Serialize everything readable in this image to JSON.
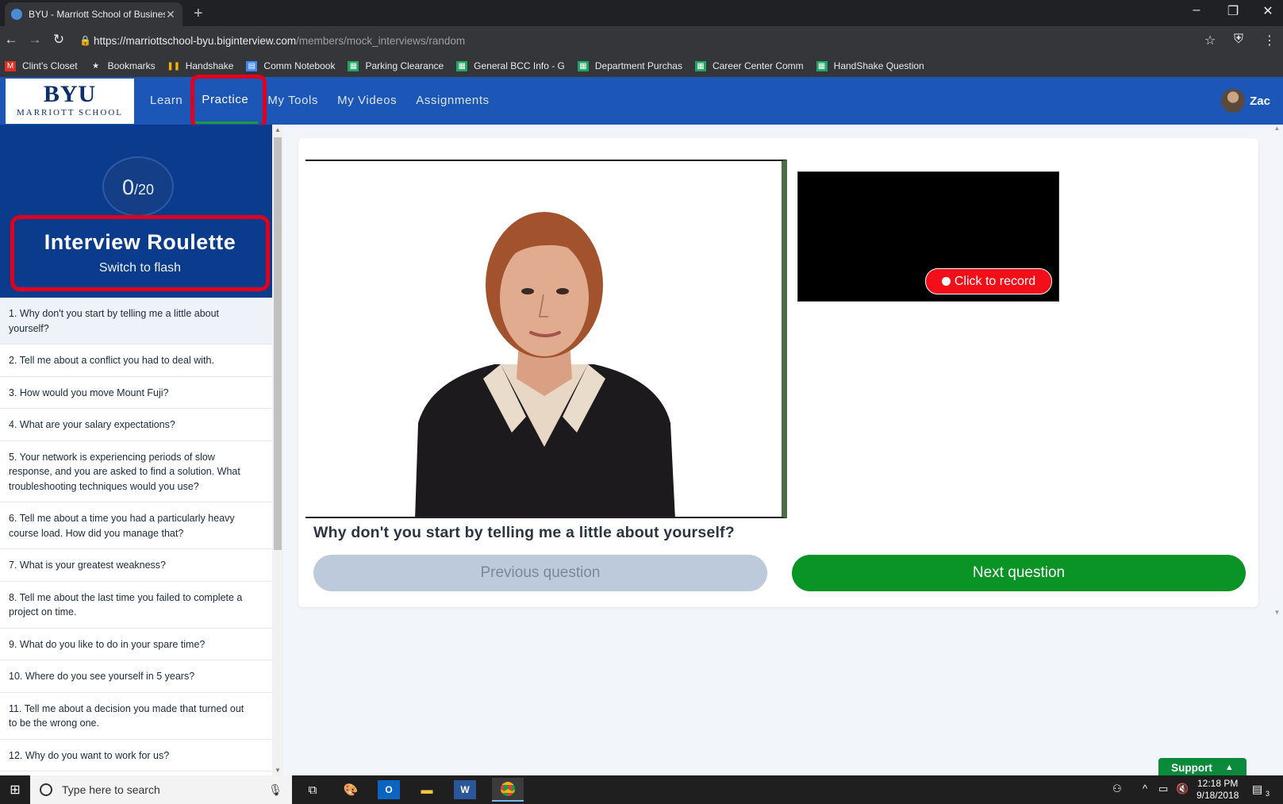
{
  "browser": {
    "tab_title": "BYU - Marriott School of Busines",
    "url_host": "https://marriottschool-byu.biginterview.com",
    "url_path": "/members/mock_interviews/random",
    "bookmarks": [
      {
        "label": "Clint's Closet",
        "icon": "red"
      },
      {
        "label": "Bookmarks",
        "icon": "star"
      },
      {
        "label": "Handshake",
        "icon": "hs"
      },
      {
        "label": "Comm Notebook",
        "icon": "doc"
      },
      {
        "label": "Parking Clearance",
        "icon": "sheet"
      },
      {
        "label": "General BCC Info - G",
        "icon": "sheet"
      },
      {
        "label": "Department Purchas",
        "icon": "sheet"
      },
      {
        "label": "Career Center Comm",
        "icon": "sheet"
      },
      {
        "label": "HandShake Question",
        "icon": "sheet"
      }
    ]
  },
  "site": {
    "logo_main": "BYU",
    "logo_sub": "MARRIOTT SCHOOL",
    "nav": [
      "Learn",
      "Practice",
      "My Tools",
      "My Videos",
      "Assignments"
    ],
    "active_nav": "Practice",
    "user_name": "Zac"
  },
  "sidebar": {
    "counter_value": "0",
    "counter_total": "/20",
    "title": "Interview Roulette",
    "subtitle": "Switch to flash",
    "questions": [
      "1. Why don't you start by telling me a little about yourself?",
      "2. Tell me about a conflict you had to deal with.",
      "3. How would you move Mount Fuji?",
      "4. What are your salary expectations?",
      "5. Your network is experiencing periods of slow response, and you are asked to find a solution. What troubleshooting techniques would you use?",
      "6. Tell me about a time you had a particularly heavy course load. How did you manage that?",
      "7. What is your greatest weakness?",
      "8. Tell me about the last time you failed to complete a project on time.",
      "9. What do you like to do in your spare time?",
      "10. Where do you see yourself in 5 years?",
      "11. Tell me about a decision you made that turned out to be the wrong one.",
      "12. Why do you want to work for us?"
    ]
  },
  "main": {
    "record_label": "Click to record",
    "question_text": "Why don't you start by telling me a little about yourself?",
    "prev_label": "Previous question",
    "next_label": "Next question",
    "support_label": "Support"
  },
  "taskbar": {
    "search_placeholder": "Type here to search",
    "time": "12:18 PM",
    "date": "9/18/2018",
    "notification_count": "3"
  },
  "colors": {
    "header_blue": "#1c57b8",
    "sidebar_navy": "#0b3b8c",
    "highlight_red": "#e0001b",
    "next_green": "#0a9425",
    "record_red": "#f20f1a"
  }
}
